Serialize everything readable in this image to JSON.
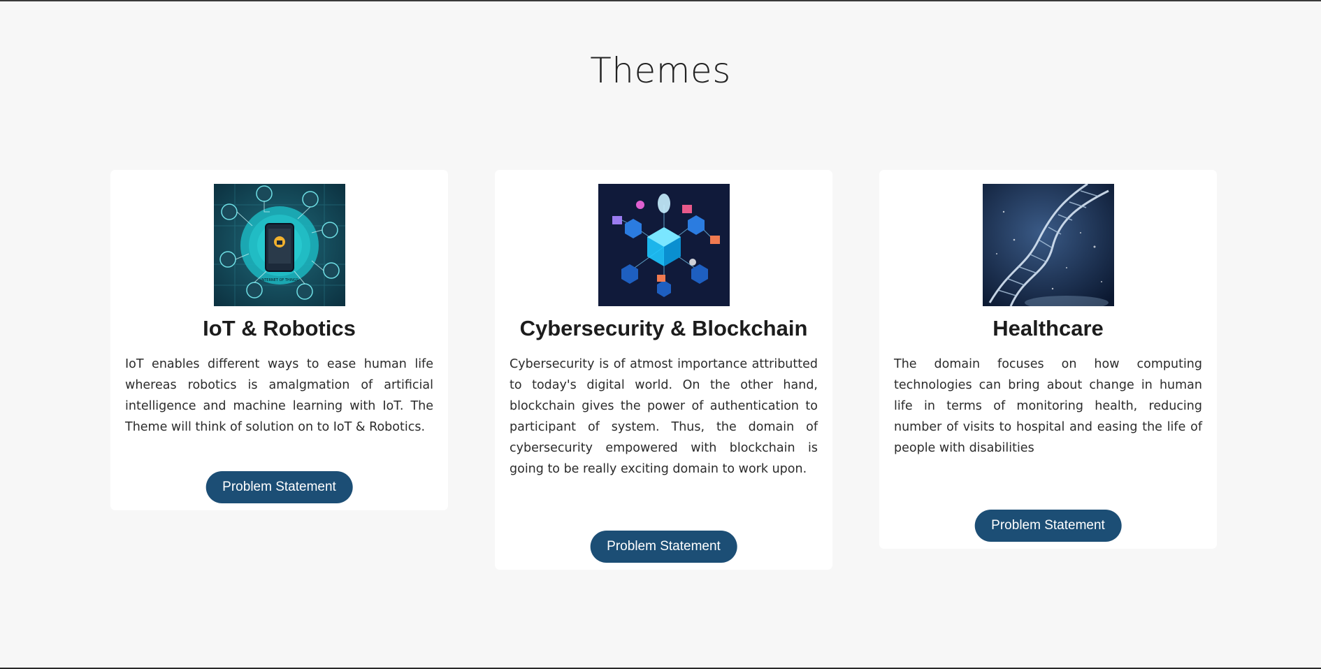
{
  "section": {
    "title": "Themes"
  },
  "colors": {
    "page_background": "#f7f7f7",
    "card_background": "#ffffff",
    "button_background": "#1c4e75",
    "button_text": "#ffffff"
  },
  "themes": [
    {
      "image_icon": "iot-illustration-image",
      "title": "IoT & Robotics",
      "description": "IoT enables different ways to ease human life whereas robotics is amalgmation of artificial intelligence and machine learning with IoT. The Theme will think of solution on to IoT & Robotics.",
      "button_label": "Problem Statement"
    },
    {
      "image_icon": "blockchain-illustration-image",
      "title": "Cybersecurity & Blockchain",
      "description": "Cybersecurity is of atmost importance attributted to today's digital world. On the other hand, blockchain gives the power of authentication to participant of system. Thus, the domain of cybersecurity empowered with blockchain is going to be really exciting domain to work upon.",
      "button_label": "Problem Statement"
    },
    {
      "image_icon": "dna-helix-image",
      "title": "Healthcare",
      "description": "The domain focuses on how computing technologies can bring about change in human life in terms of monitoring health, reducing number of visits to hospital and easing the life of people with disabilities",
      "button_label": "Problem Statement"
    }
  ]
}
